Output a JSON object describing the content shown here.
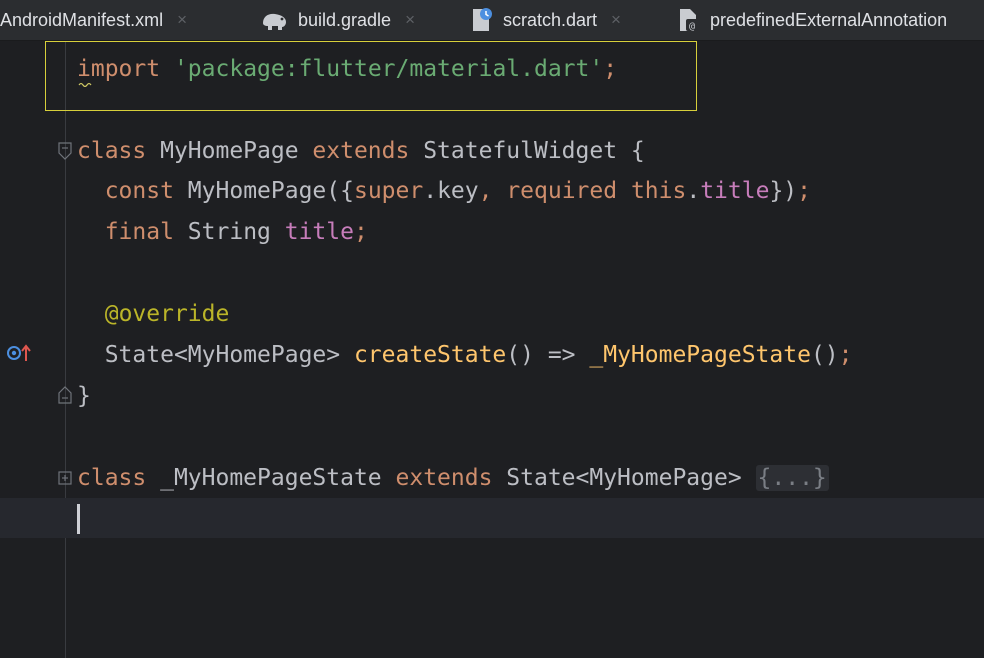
{
  "tabs": [
    {
      "label": "AndroidManifest.xml",
      "icon": "xml-file-icon",
      "close": "×"
    },
    {
      "label": "build.gradle",
      "icon": "gradle-elephant-icon",
      "close": "×"
    },
    {
      "label": "scratch.dart",
      "icon": "scratch-file-icon",
      "close": "×"
    },
    {
      "label": "predefinedExternalAnnotation",
      "icon": "annotation-file-icon"
    }
  ],
  "code": {
    "l1": {
      "kw": "import",
      "sp": " ",
      "str": "'package:flutter/material.dart'",
      "end": ";"
    },
    "l3": {
      "kw": "class",
      "a": " MyHomePage ",
      "kw2": "extends",
      "b": " StatefulWidget {"
    },
    "l4": {
      "indent": "  ",
      "kw": "const",
      "a": " MyHomePage({",
      "kw2": "super",
      "b": ".key",
      "c": ", ",
      "kw3": "required",
      "d": " ",
      "kw4": "this",
      "e": ".",
      "fld": "title",
      "f": "})",
      "end": ";"
    },
    "l5": {
      "indent": "  ",
      "kw": "final",
      "a": " String ",
      "fld": "title",
      "end": ";"
    },
    "l7": {
      "indent": "  ",
      "ann": "@",
      "a": "override"
    },
    "l8": {
      "indent": "  ",
      "a": "State<MyHomePage> ",
      "fn": "createState",
      "b": "() => ",
      "fn2": "_MyHomePageState",
      "c": "()",
      "end": ";"
    },
    "l9": {
      "a": "}"
    },
    "l11": {
      "kw": "class",
      "a": " _MyHomePageState ",
      "kw2": "extends",
      "b": " State<MyHomePage> ",
      "fold": "{...}"
    }
  },
  "colors": {
    "keyword": "#cf8e6d",
    "string": "#6aab73",
    "field": "#c77dbb",
    "function": "#ffc66d",
    "annotation": "#bbb529",
    "text": "#bcbec4",
    "highlight_border": "#d7cf3b",
    "background": "#1e1f22"
  }
}
